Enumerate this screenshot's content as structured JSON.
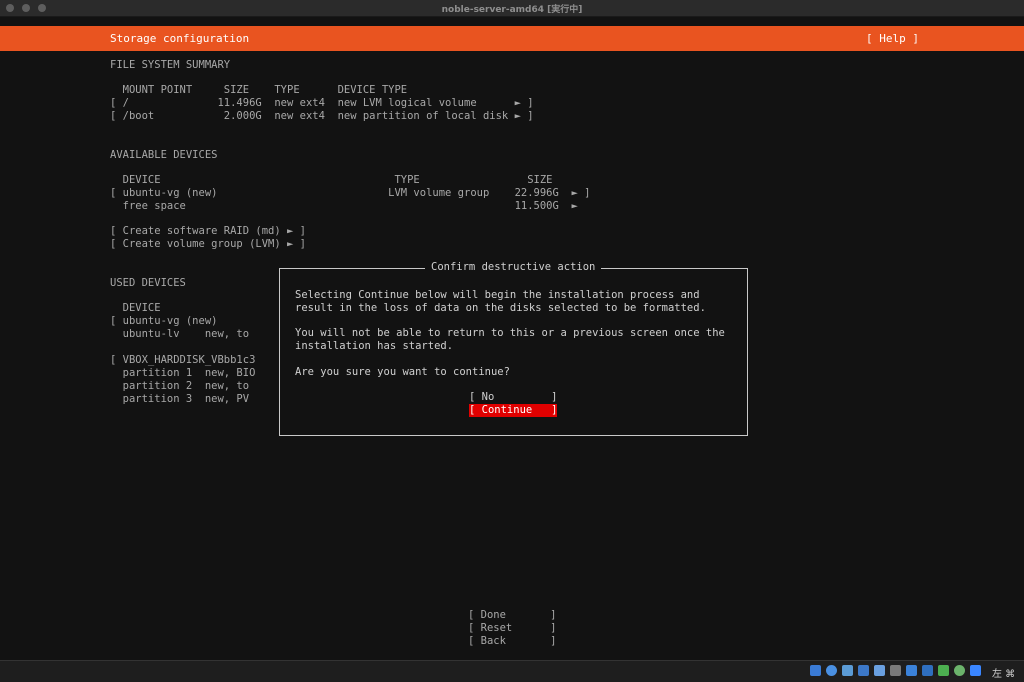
{
  "window": {
    "title": "noble-server-amd64 [実行中]"
  },
  "header": {
    "title": "Storage configuration",
    "help": "[ Help ]"
  },
  "fs_summary": {
    "heading": "FILE SYSTEM SUMMARY",
    "columns": "  MOUNT POINT     SIZE    TYPE      DEVICE TYPE",
    "rows": [
      "[ /              11.496G  new ext4  new LVM logical volume      ► ]",
      "[ /boot           2.000G  new ext4  new partition of local disk ► ]"
    ]
  },
  "available": {
    "heading": "AVAILABLE DEVICES",
    "columns": "  DEVICE                                     TYPE                 SIZE",
    "rows": [
      "[ ubuntu-vg (new)                           LVM volume group    22.996G  ► ]",
      "  free space                                                    11.500G  ►"
    ],
    "actions": [
      "[ Create software RAID (md) ► ]",
      "[ Create volume group (LVM) ► ]"
    ]
  },
  "used": {
    "heading": "USED DEVICES",
    "columns": "  DEVICE",
    "rows": [
      "[ ubuntu-vg (new)",
      "  ubuntu-lv    new, to",
      "",
      "[ VBOX_HARDDISK_VBbb1c3",
      "  partition 1  new, BIO",
      "  partition 2  new, to",
      "  partition 3  new, PV"
    ]
  },
  "dialog": {
    "title": "Confirm destructive action",
    "body": [
      "Selecting Continue below will begin the installation process and",
      "result in the loss of data on the disks selected to be formatted.",
      "",
      "You will not be able to return to this or a previous screen once the",
      "installation has started.",
      "",
      "Are you sure you want to continue?"
    ],
    "no": "[ No         ]",
    "continue": "[ Continue   ]"
  },
  "footer": {
    "done": "[ Done       ]",
    "reset": "[ Reset      ]",
    "back": "[ Back       ]"
  },
  "taskbar": {
    "host_key": "左 ⌘",
    "tray_icons": [
      "hard-disk-icon",
      "optical-drive-icon",
      "audio-icon",
      "network-icon",
      "usb-icon",
      "shared-folder-icon",
      "display-icon",
      "video-capture-icon",
      "cpu-icon",
      "recording-icon",
      "mouse-integration-icon",
      "arrow-down-icon"
    ]
  }
}
